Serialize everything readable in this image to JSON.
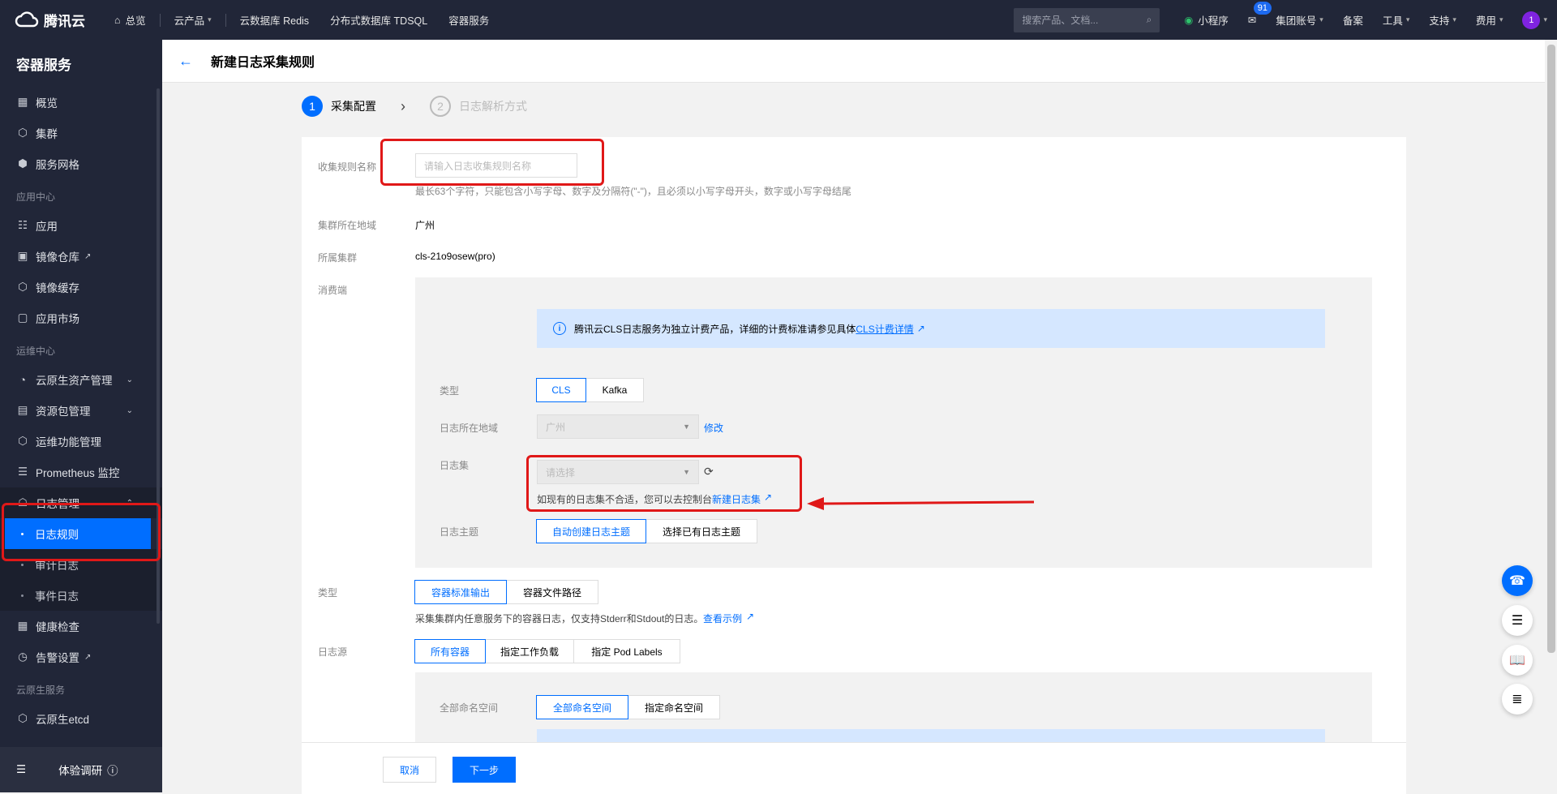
{
  "topbar": {
    "logo": "腾讯云",
    "nav": [
      "总览",
      "云产品",
      "云数据库 Redis",
      "分布式数据库 TDSQL",
      "容器服务"
    ],
    "search_placeholder": "搜索产品、文档...",
    "right": [
      "小程序",
      "集团账号",
      "备案",
      "工具",
      "支持",
      "费用"
    ],
    "badge": "91",
    "avatar": "1"
  },
  "sidebar": {
    "title": "容器服务",
    "items": [
      "概览",
      "集群",
      "服务网格"
    ],
    "group1": "应用中心",
    "items2": [
      "应用",
      "镜像仓库",
      "镜像缓存",
      "应用市场"
    ],
    "group2": "运维中心",
    "items3": [
      "云原生资产管理",
      "资源包管理",
      "运维功能管理",
      "Prometheus 监控",
      "日志管理"
    ],
    "subitems": [
      "日志规则",
      "审计日志",
      "事件日志"
    ],
    "items4": [
      "健康检查",
      "告警设置"
    ],
    "group3": "云原生服务",
    "items5": [
      "云原生etcd"
    ],
    "footer": "体验调研"
  },
  "header": {
    "title": "新建日志采集规则"
  },
  "steps": [
    {
      "num": "1",
      "label": "采集配置"
    },
    {
      "num": "2",
      "label": "日志解析方式"
    }
  ],
  "form": {
    "name_label": "收集规则名称",
    "name_placeholder": "请输入日志收集规则名称",
    "name_hint": "最长63个字符，只能包含小写字母、数字及分隔符(\"-\")，且必须以小写字母开头，数字或小写字母结尾",
    "region_label": "集群所在地域",
    "region_value": "广州",
    "cluster_label": "所属集群",
    "cluster_value": "cls-21o9osew(pro)",
    "consumer_label": "消费端",
    "info_text": "腾讯云CLS日志服务为独立计费产品，详细的计费标准请参见具体",
    "info_link": "CLS计费详情",
    "type_label": "类型",
    "type_opts": [
      "CLS",
      "Kafka"
    ],
    "log_region_label": "日志所在地域",
    "log_region_value": "广州",
    "modify": "修改",
    "logset_label": "日志集",
    "logset_placeholder": "请选择",
    "logset_hint": "如现有的日志集不合适，您可以去控制台",
    "logset_link": "新建日志集",
    "topic_label": "日志主题",
    "topic_opts": [
      "自动创建日志主题",
      "选择已有日志主题"
    ],
    "ctype_label": "类型",
    "ctype_opts": [
      "容器标准输出",
      "容器文件路径"
    ],
    "ctype_hint": "采集集群内任意服务下的容器日志，仅支持Stderr和Stdout的日志。",
    "ctype_link": "查看示例",
    "source_label": "日志源",
    "source_opts": [
      "所有容器",
      "指定工作负载",
      "指定 Pod Labels"
    ],
    "ns_label": "全部命名空间",
    "ns_opts": [
      "全部命名空间",
      "指定命名空间"
    ]
  },
  "buttons": {
    "cancel": "取消",
    "next": "下一步"
  }
}
